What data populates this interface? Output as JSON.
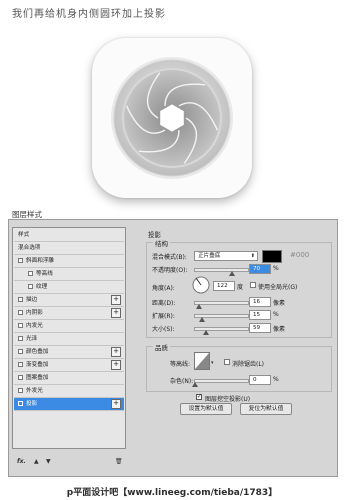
{
  "caption": "我们再给机身内侧圆环加上投影",
  "dialog_title": "图层样式",
  "styles_list": [
    {
      "label": "样式",
      "checkbox": false,
      "plus": false,
      "indent": 0,
      "selected": false
    },
    {
      "label": "混合选项",
      "checkbox": false,
      "plus": false,
      "indent": 0,
      "selected": false
    },
    {
      "label": "斜面和浮雕",
      "checkbox": true,
      "plus": false,
      "indent": 0,
      "selected": false
    },
    {
      "label": "等高线",
      "checkbox": true,
      "plus": false,
      "indent": 1,
      "selected": false
    },
    {
      "label": "纹理",
      "checkbox": true,
      "plus": false,
      "indent": 1,
      "selected": false
    },
    {
      "label": "描边",
      "checkbox": true,
      "plus": true,
      "indent": 0,
      "selected": false
    },
    {
      "label": "内阴影",
      "checkbox": true,
      "plus": true,
      "indent": 0,
      "selected": false
    },
    {
      "label": "内发光",
      "checkbox": true,
      "plus": false,
      "indent": 0,
      "selected": false
    },
    {
      "label": "光泽",
      "checkbox": true,
      "plus": false,
      "indent": 0,
      "selected": false
    },
    {
      "label": "颜色叠加",
      "checkbox": true,
      "plus": true,
      "indent": 0,
      "selected": false
    },
    {
      "label": "渐变叠加",
      "checkbox": true,
      "plus": true,
      "indent": 0,
      "selected": false
    },
    {
      "label": "图案叠加",
      "checkbox": true,
      "plus": false,
      "indent": 0,
      "selected": false
    },
    {
      "label": "外发光",
      "checkbox": true,
      "plus": false,
      "indent": 0,
      "selected": false
    },
    {
      "label": "投影",
      "checkbox": true,
      "plus": true,
      "indent": 0,
      "selected": true
    }
  ],
  "footer": {
    "fx": "fx.",
    "up": "▲",
    "down": "▼",
    "trash": "🗑"
  },
  "drop_shadow": {
    "section_title": "投影",
    "structure_title": "结构",
    "blend_mode_label": "混合模式(B):",
    "blend_mode_value": "正片叠底",
    "color_hex": "#000",
    "color_code": "#000",
    "opacity_label": "不透明度(O):",
    "opacity_value": "70",
    "opacity_unit": "%",
    "angle_label": "角度(A):",
    "angle_value": "122",
    "angle_unit": "度",
    "global_light_label": "使用全局光(G)",
    "distance_label": "距离(D):",
    "distance_value": "16",
    "distance_unit": "像素",
    "spread_label": "扩展(R):",
    "spread_value": "15",
    "spread_unit": "%",
    "size_label": "大小(S):",
    "size_value": "59",
    "size_unit": "像素",
    "quality_title": "品质",
    "contour_label": "等高线:",
    "antialias_label": "消除锯齿(L)",
    "noise_label": "杂色(N):",
    "noise_value": "0",
    "noise_unit": "%",
    "knockout_label": "图层挖空投影(U)",
    "default_button": "设置为默认值",
    "reset_button": "复位为默认值"
  },
  "watermark": "p平面设计吧【www.lineeg.com/tieba/1783】"
}
